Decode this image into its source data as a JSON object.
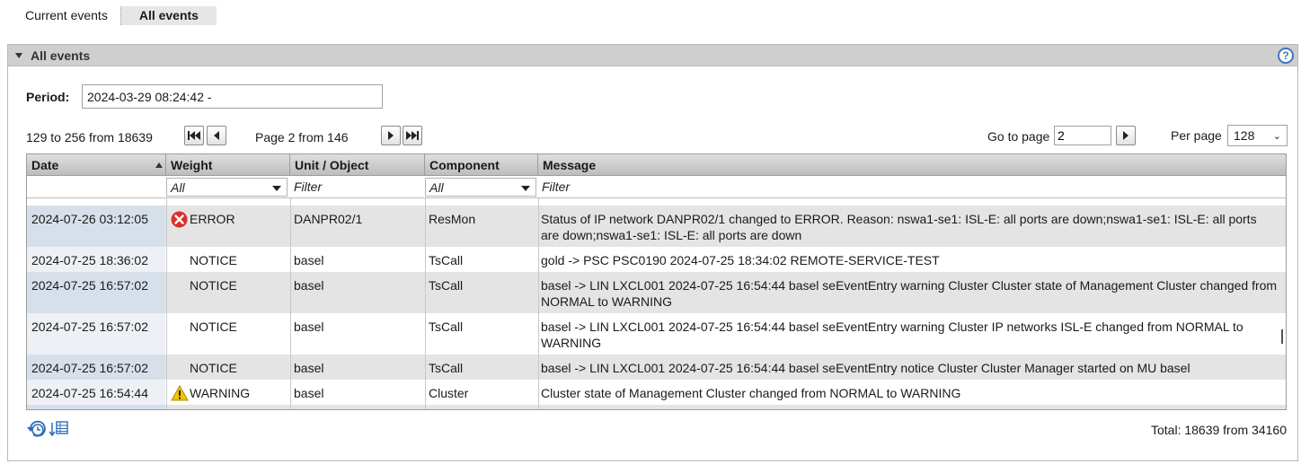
{
  "tabs": [
    {
      "label": "Current events",
      "active": false
    },
    {
      "label": "All events",
      "active": true
    }
  ],
  "panel": {
    "title": "All events",
    "help": "?"
  },
  "period": {
    "label": "Period:",
    "value": "2024-03-29 08:24:42 -"
  },
  "pager": {
    "range": "129 to 256 from 18639",
    "page_info": "Page 2 from 146",
    "goto_label": "Go to page",
    "goto_value": "2",
    "perpage_label": "Per page",
    "perpage_value": "128"
  },
  "table": {
    "columns": [
      "Date",
      "Weight",
      "Unit / Object",
      "Component",
      "Message"
    ],
    "filters": {
      "weight": "All",
      "unit": "Filter",
      "component": "All",
      "message": "Filter"
    },
    "rows": [
      {
        "date": "2024-07-26 03:12:05",
        "weight": "ERROR",
        "icon": "error-icon",
        "unit": "DANPR02/1",
        "component": "ResMon",
        "message": "Status of IP network DANPR02/1 changed to ERROR. Reason: nswa1-se1: ISL-E: all ports are down;nswa1-se1: ISL-E: all ports are down;nswa1-se1: ISL-E: all ports are down"
      },
      {
        "date": "2024-07-25 18:36:02",
        "weight": "NOTICE",
        "icon": "",
        "unit": "basel",
        "component": "TsCall",
        "message": "gold -> PSC PSC0190 2024-07-25 18:34:02 REMOTE-SERVICE-TEST"
      },
      {
        "date": "2024-07-25 16:57:02",
        "weight": "NOTICE",
        "icon": "",
        "unit": "basel",
        "component": "TsCall",
        "message": "basel -> LIN LXCL001 2024-07-25 16:54:44 basel seEventEntry warning Cluster Cluster state of Management Cluster changed from NORMAL to WARNING"
      },
      {
        "date": "2024-07-25 16:57:02",
        "weight": "NOTICE",
        "icon": "",
        "unit": "basel",
        "component": "TsCall",
        "message": "basel -> LIN LXCL001 2024-07-25 16:54:44 basel seEventEntry warning Cluster IP networks ISL-E changed from NORMAL to WARNING"
      },
      {
        "date": "2024-07-25 16:57:02",
        "weight": "NOTICE",
        "icon": "",
        "unit": "basel",
        "component": "TsCall",
        "message": "basel -> LIN LXCL001 2024-07-25 16:54:44 basel seEventEntry notice Cluster Cluster Manager started on MU basel"
      },
      {
        "date": "2024-07-25 16:54:44",
        "weight": "WARNING",
        "icon": "warning-icon",
        "unit": "basel",
        "component": "Cluster",
        "message": "Cluster state of Management Cluster changed from NORMAL to WARNING"
      }
    ]
  },
  "footer": {
    "total": "Total: 18639 from 34160"
  },
  "colors": {
    "error": "#d9302c",
    "warning": "#f2c400",
    "help": "#3a78c2"
  }
}
